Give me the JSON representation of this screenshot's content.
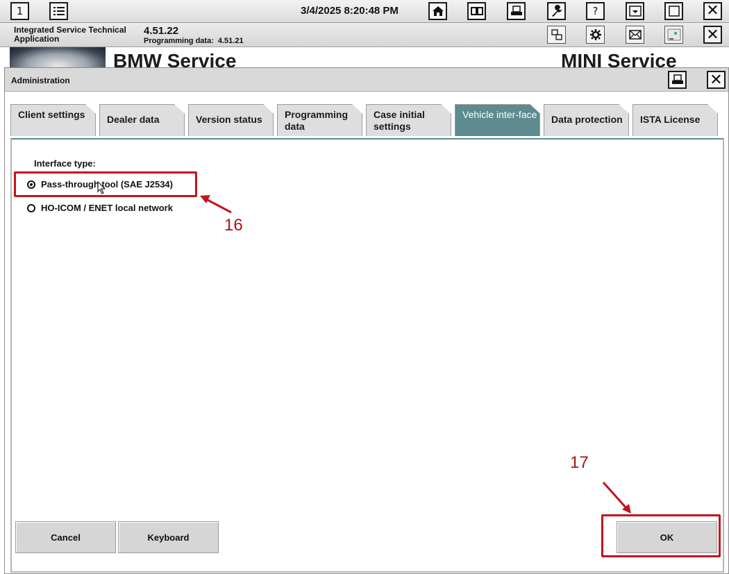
{
  "topbar": {
    "page_number": "1",
    "datetime": "3/4/2025 8:20:48 PM",
    "buttons": [
      "home-icon",
      "split-view-icon",
      "print-icon",
      "wrench-icon",
      "help-icon",
      "minimize-icon",
      "maximize-icon",
      "close-icon"
    ],
    "help_glyph": "?",
    "close_glyph": "✕"
  },
  "app": {
    "title": "Integrated Service Technical Application",
    "version": "4.51.22",
    "programming_data_label": "Programming data:",
    "programming_data_version": "4.51.21"
  },
  "brand": {
    "bmw": "BMW Service",
    "mini": "MINI Service"
  },
  "dialog": {
    "title": "Administration",
    "close_glyph": "✕",
    "tabs": [
      {
        "label": "Client settings",
        "active": false
      },
      {
        "label": "Dealer data",
        "active": false
      },
      {
        "label": "Version status",
        "active": false
      },
      {
        "label": "Programming data",
        "active": false
      },
      {
        "label": "Case initial settings",
        "active": false
      },
      {
        "label": "Vehicle inter-face",
        "active": true
      },
      {
        "label": "Data protection",
        "active": false
      },
      {
        "label": "ISTA License",
        "active": false
      }
    ],
    "interface_type_label": "Interface type:",
    "options": [
      {
        "label": "Pass-through tool (SAE J2534)",
        "selected": true
      },
      {
        "label": "HO-ICOM / ENET local network",
        "selected": false
      }
    ],
    "buttons": {
      "cancel": "Cancel",
      "keyboard": "Keyboard",
      "ok": "OK"
    }
  },
  "annotations": {
    "step_16": "16",
    "step_17": "17"
  },
  "colors": {
    "active_tab": "#5d8b8f",
    "annotation_red": "#c0151d"
  }
}
